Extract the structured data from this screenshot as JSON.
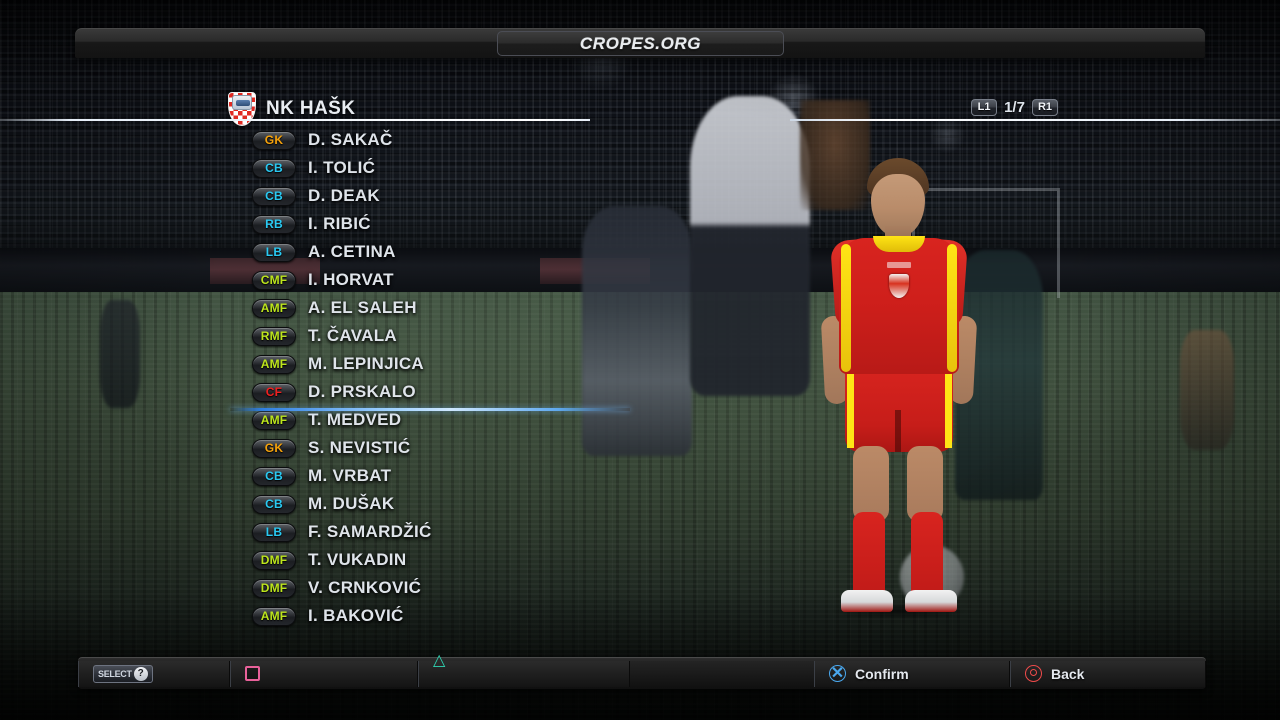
{
  "title_bar": {
    "title": "CROPES.ORG"
  },
  "team": {
    "name": "NK HAŠK",
    "crest_icon": "croatian-checkerboard-crest"
  },
  "page_indicator": {
    "left_shoulder": "L1",
    "right_shoulder": "R1",
    "page": "1/7"
  },
  "roster": {
    "players": [
      {
        "pos": "GK",
        "name": "D. SAKAČ"
      },
      {
        "pos": "CB",
        "name": "I. TOLIĆ"
      },
      {
        "pos": "CB",
        "name": "D. DEAK"
      },
      {
        "pos": "RB",
        "name": "I. RIBIĆ"
      },
      {
        "pos": "LB",
        "name": "A. CETINA"
      },
      {
        "pos": "CMF",
        "name": "I. HORVAT"
      },
      {
        "pos": "AMF",
        "name": "A. EL SALEH"
      },
      {
        "pos": "RMF",
        "name": "T. ČAVALA"
      },
      {
        "pos": "AMF",
        "name": "M. LEPINJICA"
      },
      {
        "pos": "CF",
        "name": "D. PRSKALO"
      },
      {
        "pos": "AMF",
        "name": "T. MEDVED"
      },
      {
        "pos": "GK",
        "name": "S. NEVISTIĆ"
      },
      {
        "pos": "CB",
        "name": "M. VRBAT"
      },
      {
        "pos": "CB",
        "name": "M. DUŠAK"
      },
      {
        "pos": "LB",
        "name": "F. SAMARDŽIĆ"
      },
      {
        "pos": "DMF",
        "name": "T. VUKADIN"
      },
      {
        "pos": "DMF",
        "name": "V. CRNKOVIĆ"
      },
      {
        "pos": "AMF",
        "name": "I. BAKOVIĆ"
      }
    ],
    "starting_lineup_count": 10
  },
  "command_bar": {
    "select": {
      "button": "SELECT",
      "icon": "question-mark-icon",
      "label": ""
    },
    "square": {
      "icon": "square-button-icon",
      "label": ""
    },
    "triangle": {
      "icon": "triangle-button-icon",
      "label": ""
    },
    "confirm": {
      "icon": "cross-button-icon",
      "label": "Confirm"
    },
    "back": {
      "icon": "circle-button-icon",
      "label": "Back"
    }
  },
  "colors": {
    "pos_gk": "#f5a20c",
    "pos_def": "#29c9f2",
    "pos_mid": "#bde51c",
    "pos_fwd": "#ef2020",
    "kit_primary": "#d8241f",
    "kit_secondary": "#ffe415",
    "confirm_blue": "#4aa8ee",
    "back_red": "#ef4a4a"
  }
}
